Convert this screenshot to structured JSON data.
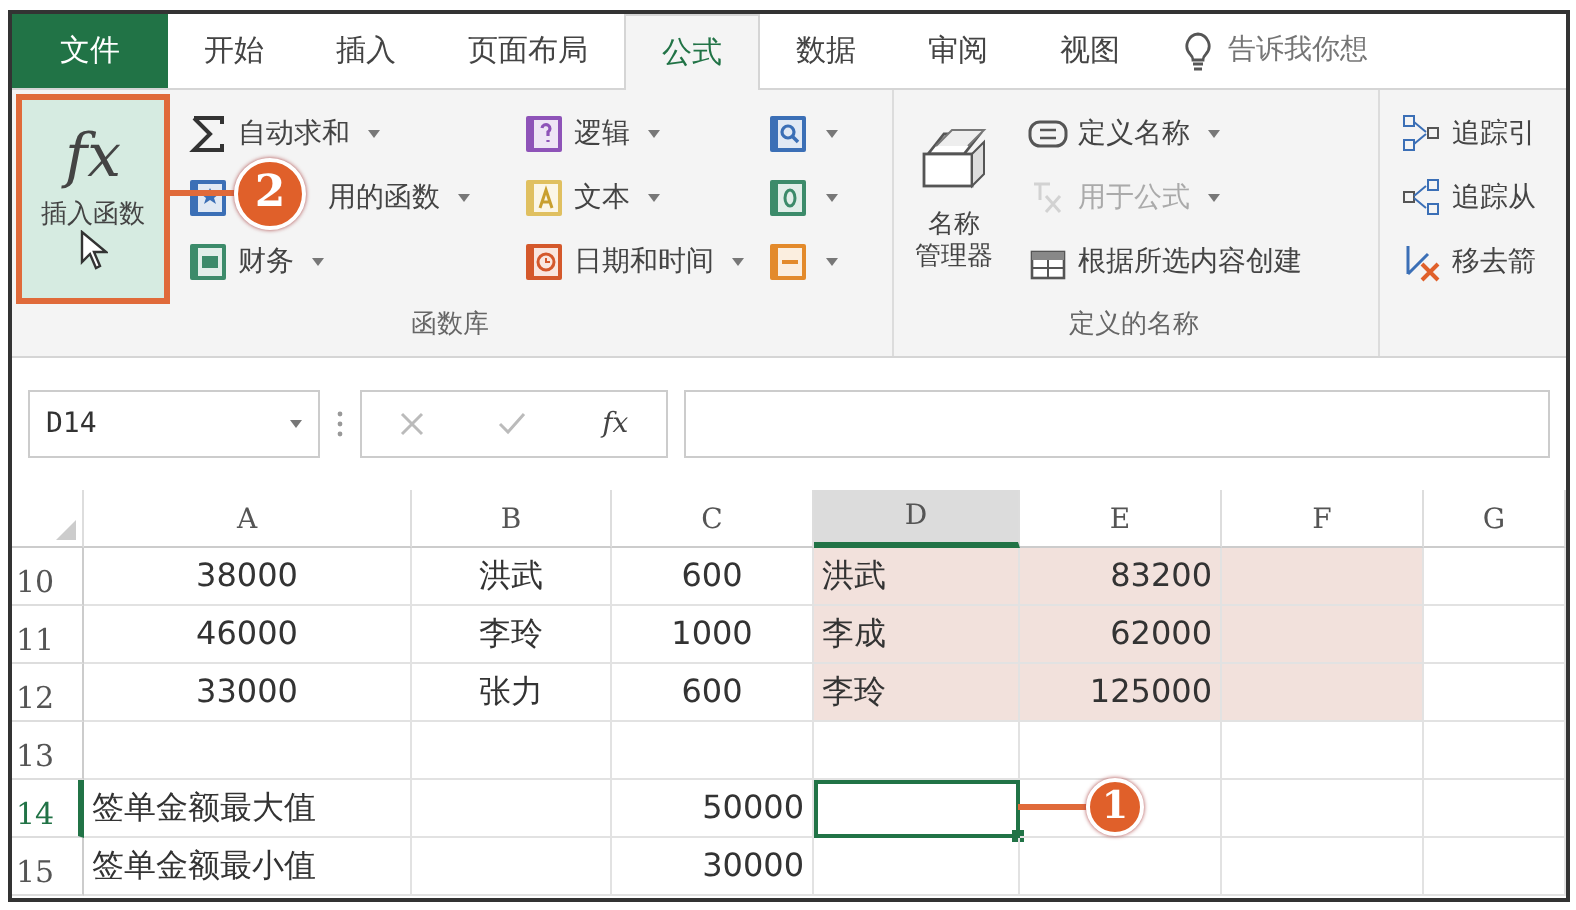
{
  "tabs": [
    {
      "label": "文件",
      "kind": "file",
      "selected": false
    },
    {
      "label": "开始",
      "kind": "tab",
      "selected": false
    },
    {
      "label": "插入",
      "kind": "tab",
      "selected": false
    },
    {
      "label": "页面布局",
      "kind": "tab",
      "selected": false
    },
    {
      "label": "公式",
      "kind": "tab",
      "selected": true
    },
    {
      "label": "数据",
      "kind": "tab",
      "selected": false
    },
    {
      "label": "审阅",
      "kind": "tab",
      "selected": false
    },
    {
      "label": "视图",
      "kind": "tab",
      "selected": false
    }
  ],
  "tell_me": {
    "placeholder": "告诉我你想"
  },
  "ribbon": {
    "groups": [
      {
        "label": "函数库",
        "big_button": {
          "kind": "fx",
          "symbol": "fx",
          "label_lines": [
            "插入函数"
          ],
          "highlighted": true
        },
        "columns": [
          [
            {
              "kind": "sigma",
              "label": "自动求和",
              "dropdown": true,
              "disabled": false
            },
            {
              "kind": "recent",
              "label": "用的函数",
              "dropdown": true,
              "disabled": false
            },
            {
              "kind": "finance",
              "label": "财务",
              "dropdown": true,
              "disabled": false
            }
          ],
          [
            {
              "kind": "logic",
              "label": "逻辑",
              "dropdown": true,
              "disabled": false
            },
            {
              "kind": "text",
              "label": "文本",
              "dropdown": true,
              "disabled": false
            },
            {
              "kind": "datetime",
              "label": "日期和时间",
              "dropdown": true,
              "disabled": false
            }
          ],
          [
            {
              "kind": "lookup",
              "dropdown": true,
              "disabled": false
            },
            {
              "kind": "math",
              "dropdown": true,
              "disabled": false
            },
            {
              "kind": "more",
              "dropdown": true,
              "disabled": false
            }
          ]
        ]
      },
      {
        "label": "定义的名称",
        "big_button": {
          "kind": "name-manager",
          "label_lines": [
            "名称",
            "管理器"
          ],
          "highlighted": false
        },
        "columns": [
          [
            {
              "kind": "define-name",
              "label": "定义名称",
              "dropdown": true,
              "disabled": false
            },
            {
              "kind": "use-in-formula",
              "label": "用于公式",
              "dropdown": true,
              "disabled": true
            },
            {
              "kind": "create-from-selection",
              "label": "根据所选内容创建",
              "dropdown": false,
              "disabled": false
            }
          ]
        ]
      },
      {
        "columns": [
          [
            {
              "kind": "trace-precedents",
              "label": "追踪引",
              "dropdown": false,
              "disabled": false
            },
            {
              "kind": "trace-dependents",
              "label": "追踪从",
              "dropdown": false,
              "disabled": false
            },
            {
              "kind": "remove-arrows",
              "label": "移去箭",
              "dropdown": false,
              "disabled": false
            }
          ]
        ]
      }
    ]
  },
  "formula_bar": {
    "name_box": "D14",
    "fx": "fx"
  },
  "table": {
    "columns": [
      {
        "label": "A",
        "selected": false
      },
      {
        "label": "B",
        "selected": false
      },
      {
        "label": "C",
        "selected": false
      },
      {
        "label": "D",
        "selected": true
      },
      {
        "label": "E",
        "selected": false
      },
      {
        "label": "F",
        "selected": false
      },
      {
        "label": "G",
        "selected": false
      }
    ],
    "rows": [
      {
        "header": "10",
        "active": false,
        "cells": {
          "A": {
            "text": "38000",
            "kind": "centered",
            "shaded": false
          },
          "B": {
            "text": "洪武",
            "kind": "centered",
            "shaded": false
          },
          "C": {
            "text": "600",
            "kind": "centered",
            "shaded": false
          },
          "D": {
            "text": "洪武",
            "kind": "text",
            "shaded": true
          },
          "E": {
            "text": "83200",
            "kind": "number",
            "shaded": true
          },
          "F": {
            "shaded": true
          }
        }
      },
      {
        "header": "11",
        "active": false,
        "cells": {
          "A": {
            "text": "46000",
            "kind": "centered",
            "shaded": false
          },
          "B": {
            "text": "李玲",
            "kind": "centered",
            "shaded": false
          },
          "C": {
            "text": "1000",
            "kind": "centered",
            "shaded": false
          },
          "D": {
            "text": "李成",
            "kind": "text",
            "shaded": true
          },
          "E": {
            "text": "62000",
            "kind": "number",
            "shaded": true
          },
          "F": {
            "shaded": true
          }
        }
      },
      {
        "header": "12",
        "active": false,
        "cells": {
          "A": {
            "text": "33000",
            "kind": "centered",
            "shaded": false
          },
          "B": {
            "text": "张力",
            "kind": "centered",
            "shaded": false
          },
          "C": {
            "text": "600",
            "kind": "centered",
            "shaded": false
          },
          "D": {
            "text": "李玲",
            "kind": "text",
            "shaded": true
          },
          "E": {
            "text": "125000",
            "kind": "number",
            "shaded": true
          },
          "F": {
            "shaded": true
          }
        }
      },
      {
        "header": "13",
        "active": false,
        "cells": {}
      },
      {
        "header": "14",
        "active": true,
        "cells": {
          "A": {
            "text": "签单金额最大值",
            "kind": "text",
            "shaded": false
          },
          "C": {
            "text": "50000",
            "kind": "number",
            "shaded": false
          },
          "D": {
            "active": true
          }
        }
      },
      {
        "header": "15",
        "active": false,
        "cells": {
          "A": {
            "text": "签单金额最小值",
            "kind": "text",
            "shaded": false
          },
          "C": {
            "text": "30000",
            "kind": "number",
            "shaded": false
          }
        }
      }
    ]
  },
  "callouts": [
    {
      "text": "1",
      "kind": "cell"
    },
    {
      "text": "2",
      "kind": "button"
    }
  ]
}
